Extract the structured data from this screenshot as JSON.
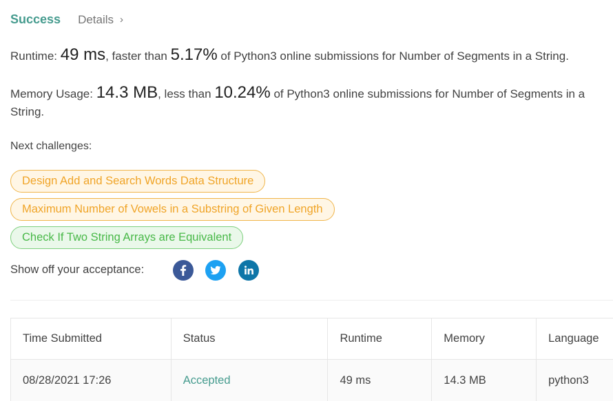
{
  "header": {
    "status": "Success",
    "details_label": "Details",
    "details_chevron": "›"
  },
  "runtime": {
    "prefix": "Runtime: ",
    "value": "49 ms",
    "middle": ", faster than ",
    "percent": "5.17%",
    "suffix": " of Python3 online submissions for Number of Segments in a String."
  },
  "memory": {
    "prefix": "Memory Usage: ",
    "value": "14.3 MB",
    "middle": ", less than ",
    "percent": "10.24%",
    "suffix": " of Python3 online submissions for Number of Segments in a String."
  },
  "next_challenges": {
    "label": "Next challenges:",
    "items": [
      {
        "title": "Design Add and Search Words Data Structure",
        "difficulty": "medium"
      },
      {
        "title": "Maximum Number of Vowels in a Substring of Given Length",
        "difficulty": "medium"
      },
      {
        "title": "Check If Two String Arrays are Equivalent",
        "difficulty": "easy"
      }
    ]
  },
  "share": {
    "label": "Show off your acceptance:",
    "icons": [
      "facebook-icon",
      "twitter-icon",
      "linkedin-icon"
    ]
  },
  "table": {
    "headers": [
      "Time Submitted",
      "Status",
      "Runtime",
      "Memory",
      "Language"
    ],
    "rows": [
      [
        "08/28/2021 17:26",
        "Accepted",
        "49 ms",
        "14.3 MB",
        "python3"
      ]
    ]
  },
  "colors": {
    "success": "#459b8e",
    "medium_text": "#f0a427",
    "medium_bg": "#fff6e5",
    "easy_text": "#47b847",
    "easy_bg": "#eaf8ea",
    "facebook": "#3b5998",
    "twitter": "#1da1f2",
    "linkedin": "#0e76a8"
  }
}
